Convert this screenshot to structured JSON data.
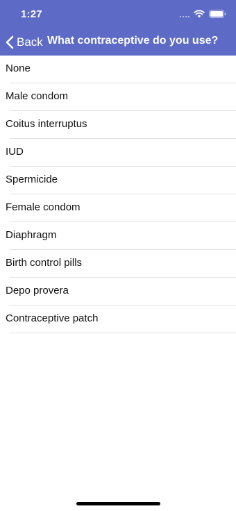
{
  "status_bar": {
    "time": "1:27"
  },
  "nav": {
    "back_label": "Back",
    "title": "What contraceptive do you use?"
  },
  "options": [
    {
      "label": "None"
    },
    {
      "label": "Male condom"
    },
    {
      "label": "Coitus interruptus"
    },
    {
      "label": "IUD"
    },
    {
      "label": "Spermicide"
    },
    {
      "label": "Female condom"
    },
    {
      "label": "Diaphragm"
    },
    {
      "label": "Birth control pills"
    },
    {
      "label": "Depo provera"
    },
    {
      "label": "Contraceptive patch"
    }
  ],
  "colors": {
    "header_background": "#5e6bc6",
    "header_text": "#ffffff",
    "list_text": "#111111",
    "divider": "#e2e2e2"
  },
  "icons": {
    "back": "chevron-left-icon",
    "wifi": "wifi-icon",
    "battery": "battery-icon",
    "signal": "cellular-signal-icon"
  }
}
